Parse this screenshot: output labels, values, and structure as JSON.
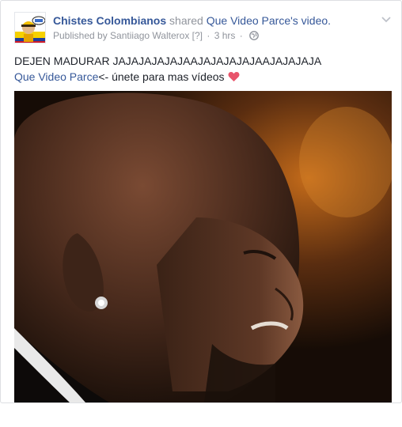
{
  "post": {
    "page_name": "Chistes Colombianos",
    "shared_text": "shared",
    "shared_source": "Que Video Parce's",
    "shared_object": "video.",
    "published_by": "Published by Santiiago Walterox",
    "help_marker": "[?]",
    "separator": "·",
    "timestamp": "3 hrs",
    "separator2": "·",
    "privacy_icon": "globe-icon",
    "menu_icon": "chevron-down-icon",
    "text_line1": "DEJEN MADURAR JAJAJAJAJAJAAJAJAJAJAJAAJAJAJAJA",
    "mention": "Que Video Parce",
    "text_line2_suffix": "<- únete para mas vídeos",
    "emoji": "heart-icon"
  },
  "colors": {
    "link": "#365899",
    "muted": "#90949c",
    "text": "#1d2129",
    "heart": "#e8546b"
  }
}
